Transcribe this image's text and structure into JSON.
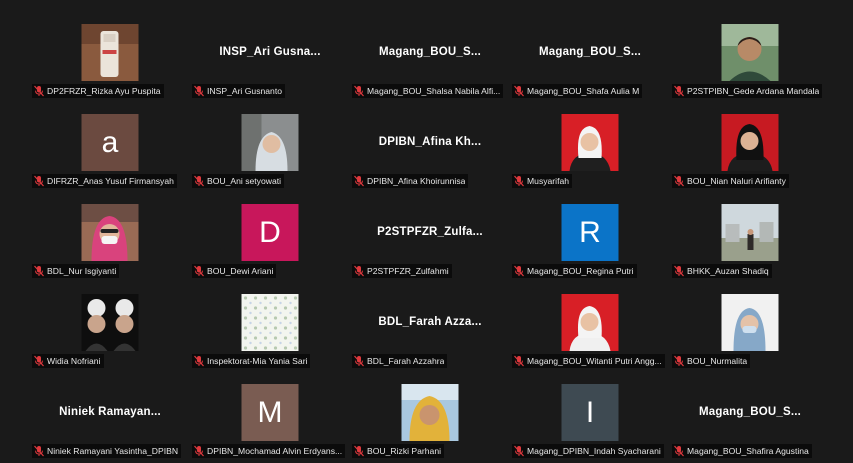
{
  "colors": {
    "background": "#1a1a1a",
    "mic_muted": "#e0393e"
  },
  "participants": [
    {
      "name": "DP2FRZR_Rizka Ayu Puspita",
      "tile": "",
      "kind": "video",
      "style": "bottle"
    },
    {
      "name": "INSP_Ari Gusnanto",
      "tile": "INSP_Ari  Gusna...",
      "kind": "name"
    },
    {
      "name": "Magang_BOU_Shalsa Nabila Alfi...",
      "tile": "Magang_BOU_S...",
      "kind": "name"
    },
    {
      "name": "Magang_BOU_Shafa Aulia M",
      "tile": "Magang_BOU_S...",
      "kind": "name"
    },
    {
      "name": "P2STPIBN_Gede Ardana Mandala",
      "tile": "",
      "kind": "video",
      "style": "man-green"
    },
    {
      "name": "DIFRZR_Anas Yusuf Firmansyah",
      "tile": "a",
      "kind": "initial",
      "color": "#6b4a40"
    },
    {
      "name": "BOU_Ani setyowati",
      "tile": "",
      "kind": "video",
      "style": "hijab-grey"
    },
    {
      "name": "DPIBN_Afina Khoirunnisa",
      "tile": "DPIBN_Afina  Kh...",
      "kind": "name"
    },
    {
      "name": "Musyarifah",
      "tile": "",
      "kind": "video",
      "style": "red-white-hijab"
    },
    {
      "name": "BOU_Nian Naluri Arifianty",
      "tile": "",
      "kind": "video",
      "style": "red-black-hijab"
    },
    {
      "name": "BDL_Nur Isgiyanti",
      "tile": "",
      "kind": "video",
      "style": "mask-pink"
    },
    {
      "name": "BOU_Dewi Ariani",
      "tile": "D",
      "kind": "initial",
      "color": "#c8175b"
    },
    {
      "name": "P2STPFZR_Zulfahmi",
      "tile": "P2STPFZR_Zulfa...",
      "kind": "name"
    },
    {
      "name": "Magang_BOU_Regina Putri",
      "tile": "R",
      "kind": "initial",
      "color": "#0b74c8"
    },
    {
      "name": "BHKK_Auzan Shadiq",
      "tile": "",
      "kind": "video",
      "style": "outdoor"
    },
    {
      "name": "Widia Nofriani",
      "tile": "",
      "kind": "video",
      "style": "dark-duo"
    },
    {
      "name": "Inspektorat-Mia Yania Sari",
      "tile": "",
      "kind": "video",
      "style": "pattern"
    },
    {
      "name": "BDL_Farah Azzahra",
      "tile": "BDL_Farah  Azza...",
      "kind": "name"
    },
    {
      "name": "Magang_BOU_Witanti Putri Angg...",
      "tile": "",
      "kind": "video",
      "style": "red-white-hijab2"
    },
    {
      "name": "BOU_Nurmalita",
      "tile": "",
      "kind": "video",
      "style": "blue-hijab"
    },
    {
      "name": "Niniek Ramayani Yasintha_DPIBN",
      "tile": "Niniek  Ramayan...",
      "kind": "name"
    },
    {
      "name": "DPIBN_Mochamad Alvin Erdyans...",
      "tile": "M",
      "kind": "initial",
      "color": "#7a5c52"
    },
    {
      "name": "BOU_Rizki Parhani",
      "tile": "",
      "kind": "video",
      "style": "yellow-hijab"
    },
    {
      "name": "Magang_DPIBN_Indah Syacharani",
      "tile": "I",
      "kind": "initial",
      "color": "#3e4a52"
    },
    {
      "name": "Magang_BOU_Shafira Agustina",
      "tile": "Magang_BOU_S...",
      "kind": "name"
    }
  ]
}
